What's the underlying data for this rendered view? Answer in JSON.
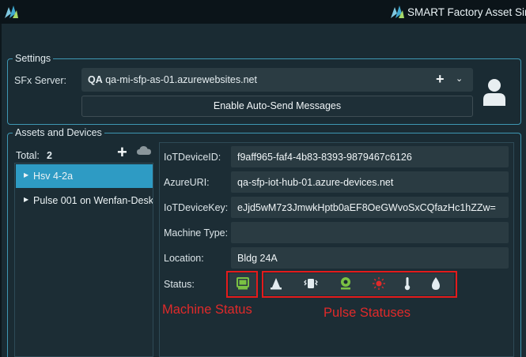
{
  "window": {
    "title": "SMART Factory Asset Sim"
  },
  "settings": {
    "legend": "Settings",
    "server_label": "SFx Server:",
    "server_env": "QA",
    "server_host": "qa-mi-sfp-as-01.azurewebsites.net",
    "auto_send_label": "Enable Auto-Send Messages"
  },
  "assets": {
    "legend": "Assets and Devices",
    "total_label": "Total:",
    "total_value": "2",
    "items": [
      {
        "label": "Hsv 4-2a",
        "selected": true
      },
      {
        "label": "Pulse 001 on Wenfan-Desk",
        "selected": false
      }
    ]
  },
  "device": {
    "fields": [
      {
        "label": "IoTDeviceID:",
        "value": "f9aff965-faf4-4b83-8393-9879467c6126"
      },
      {
        "label": "AzureURI:",
        "value": "qa-sfp-iot-hub-01.azure-devices.net"
      },
      {
        "label": "IoTDeviceKey:",
        "value": "eJjd5wM7z3JmwkHptb0aEF8OeGWvoSxCQfazHc1hZZw="
      },
      {
        "label": "Machine Type:",
        "value": ""
      },
      {
        "label": "Location:",
        "value": "Bldg 24A"
      }
    ],
    "status_label": "Status:"
  },
  "annotations": {
    "machine_status": "Machine Status",
    "pulse_statuses": "Pulse Statuses"
  },
  "colors": {
    "accent": "#2e9bc4",
    "status_green": "#7ac143",
    "status_red": "#e02a2a",
    "annotation_red": "#e41b1b"
  },
  "icons": {
    "machine_status": "monitor-icon",
    "pulse": [
      "cone-icon",
      "vibration-icon",
      "sensor-icon",
      "sun-icon",
      "thermometer-icon",
      "drop-icon"
    ]
  }
}
